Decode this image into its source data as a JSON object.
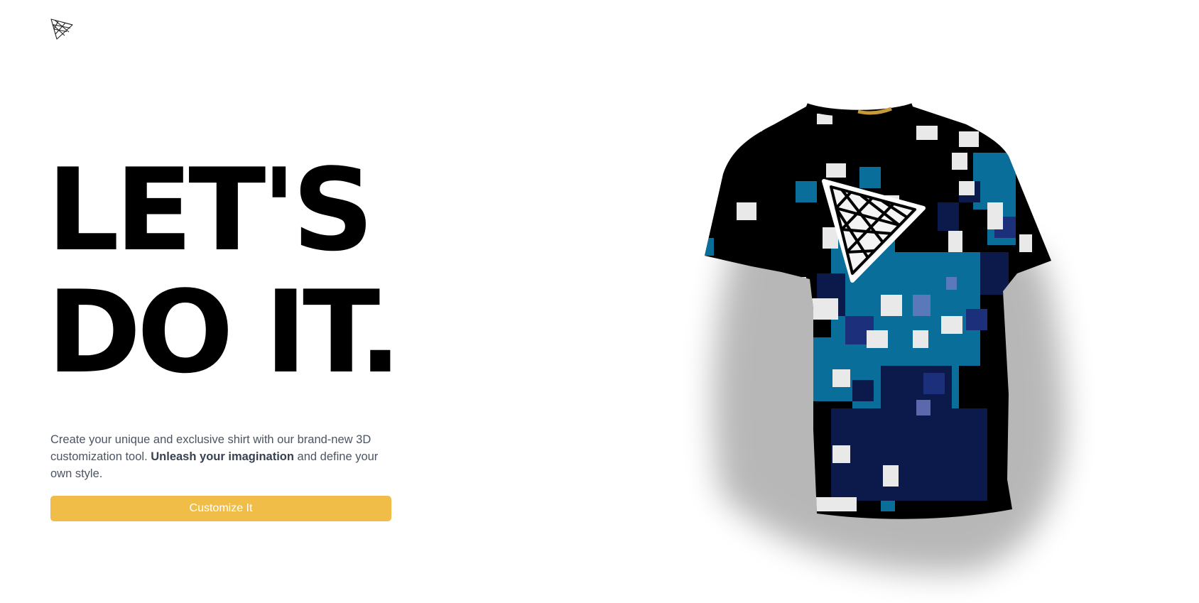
{
  "brand": {
    "logo_icon": "triangle-grid-icon"
  },
  "hero": {
    "line1": "LET'S",
    "line2": "DO IT."
  },
  "intro": {
    "text_before": "Create your unique and exclusive shirt with our brand-new 3D customization tool.",
    "emphasis": "Unleash your imagination",
    "text_after": "and define your own style."
  },
  "cta": {
    "label": "Customize It"
  },
  "colors": {
    "accent": "#efbd48",
    "text_dark": "#000000",
    "text_muted": "#4b5563",
    "shirt_base": "#000000",
    "shirt_blue": "#0a6e9a",
    "shirt_navy": "#0b1a4a"
  },
  "preview": {
    "subject": "t-shirt-3d-model",
    "decal_icon": "triangle-grid-icon"
  }
}
